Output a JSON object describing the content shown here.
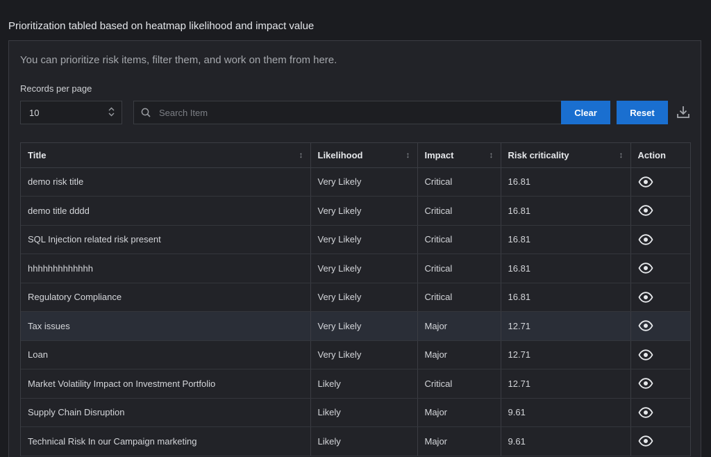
{
  "page": {
    "title": "Prioritization tabled based on heatmap likelihood and impact value",
    "intro": "You can prioritize risk items, filter them, and work on them from here."
  },
  "controls": {
    "records_label": "Records per page",
    "records_value": "10",
    "search_placeholder": "Search Item",
    "clear_label": "Clear",
    "reset_label": "Reset"
  },
  "icons": {
    "search": "search-icon",
    "download": "download-icon",
    "sort": "sort-icon",
    "view": "eye-icon"
  },
  "colors": {
    "primary_button": "#1a6fd0",
    "background": "#1b1c20",
    "highlight_row": "#2a2e37"
  },
  "table": {
    "columns": [
      "Title",
      "Likelihood",
      "Impact",
      "Risk criticality",
      "Action"
    ],
    "highlighted_row": 5,
    "rows": [
      {
        "title": "demo risk title",
        "likelihood": "Very Likely",
        "impact": "Critical",
        "criticality": "16.81"
      },
      {
        "title": "demo title dddd",
        "likelihood": "Very Likely",
        "impact": "Critical",
        "criticality": "16.81"
      },
      {
        "title": "SQL Injection related risk present",
        "likelihood": "Very Likely",
        "impact": "Critical",
        "criticality": "16.81"
      },
      {
        "title": "hhhhhhhhhhhhh",
        "likelihood": "Very Likely",
        "impact": "Critical",
        "criticality": "16.81"
      },
      {
        "title": "Regulatory Compliance",
        "likelihood": "Very Likely",
        "impact": "Critical",
        "criticality": "16.81"
      },
      {
        "title": "Tax issues",
        "likelihood": "Very Likely",
        "impact": "Major",
        "criticality": "12.71"
      },
      {
        "title": "Loan",
        "likelihood": "Very Likely",
        "impact": "Major",
        "criticality": "12.71"
      },
      {
        "title": "Market Volatility Impact on Investment Portfolio",
        "likelihood": "Likely",
        "impact": "Critical",
        "criticality": "12.71"
      },
      {
        "title": "Supply Chain Disruption",
        "likelihood": "Likely",
        "impact": "Major",
        "criticality": "9.61"
      },
      {
        "title": "Technical Risk In our Campaign marketing",
        "likelihood": "Likely",
        "impact": "Major",
        "criticality": "9.61"
      }
    ]
  }
}
